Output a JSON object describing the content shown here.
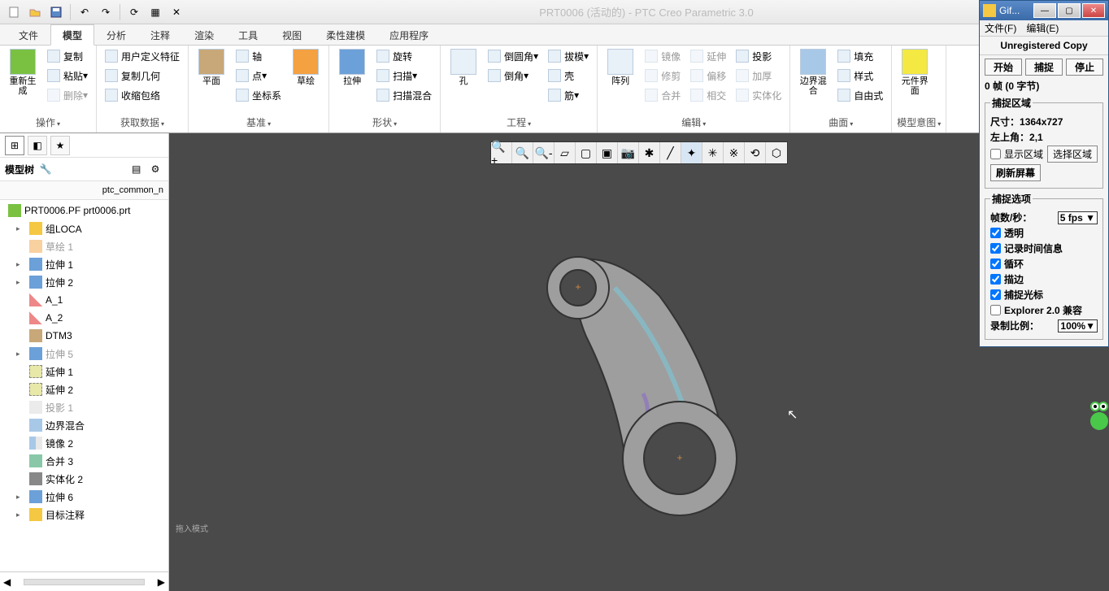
{
  "app_title": "PRT0006 (活动的) - PTC Creo Parametric 3.0",
  "tabs": [
    "文件",
    "模型",
    "分析",
    "注释",
    "渲染",
    "工具",
    "视图",
    "柔性建模",
    "应用程序"
  ],
  "active_tab": 1,
  "ribbon_groups": [
    {
      "label": "操作",
      "items": {
        "regen": "重新生成",
        "copy": "复制",
        "paste": "粘贴",
        "delete": "删除"
      }
    },
    {
      "label": "获取数据",
      "items": {
        "udf": "用户定义特征",
        "copygeom": "复制几何",
        "shrinkwrap": "收缩包络"
      }
    },
    {
      "label": "基准",
      "items": {
        "plane": "平面",
        "sketch": "草绘",
        "axis": "轴",
        "point": "点",
        "csys": "坐标系"
      }
    },
    {
      "label": "形状",
      "items": {
        "extrude": "拉伸",
        "revolve": "旋转",
        "sweep": "扫描",
        "sweepblend": "扫描混合"
      }
    },
    {
      "label": "工程",
      "items": {
        "hole": "孔",
        "round": "倒圆角",
        "chamfer": "倒角",
        "draft": "拔模",
        "shell": "壳",
        "rib": "筋"
      }
    },
    {
      "label": "编辑",
      "items": {
        "pattern": "阵列",
        "mirror": "镜像",
        "trim": "修剪",
        "merge": "合并",
        "extend": "延伸",
        "offset": "偏移",
        "intersect": "相交",
        "project": "投影",
        "thicken": "加厚",
        "solidify": "实体化"
      }
    },
    {
      "label": "曲面",
      "items": {
        "boundary": "边界混合",
        "fill": "填充",
        "style": "样式",
        "freeform": "自由式"
      }
    },
    {
      "label": "模型意图",
      "items": {
        "compinterface": "元件界面"
      }
    }
  ],
  "sidebar": {
    "title": "模型树",
    "search_path": "ptc_common_n",
    "filename": "PRT0006.PF prt0006.prt",
    "tree": [
      {
        "icon": "folder",
        "label": "组LOCA",
        "expand": true
      },
      {
        "icon": "sketch",
        "label": "草绘 1",
        "dim": true
      },
      {
        "icon": "extrude",
        "label": "拉伸 1",
        "expand": true
      },
      {
        "icon": "extrude",
        "label": "拉伸 2",
        "expand": true
      },
      {
        "icon": "axis",
        "label": "A_1"
      },
      {
        "icon": "axis",
        "label": "A_2"
      },
      {
        "icon": "datum",
        "label": "DTM3"
      },
      {
        "icon": "extrude",
        "label": "拉伸 5",
        "dim": true,
        "expand": true
      },
      {
        "icon": "extend",
        "label": "延伸 1"
      },
      {
        "icon": "extend",
        "label": "延伸 2"
      },
      {
        "icon": "project",
        "label": "投影 1",
        "dim": true
      },
      {
        "icon": "boundary",
        "label": "边界混合"
      },
      {
        "icon": "mirror",
        "label": "镜像 2"
      },
      {
        "icon": "merge",
        "label": "合并 3"
      },
      {
        "icon": "solidify",
        "label": "实体化 2"
      },
      {
        "icon": "extrude",
        "label": "拉伸 6",
        "expand": true
      },
      {
        "icon": "folder",
        "label": "目标注释",
        "expand": true
      }
    ]
  },
  "status_hint": "拖入模式",
  "gif": {
    "title": "Gif...",
    "menu": [
      "文件(F)",
      "编辑(E)"
    ],
    "banner": "Unregistered Copy",
    "buttons": {
      "start": "开始",
      "capture": "捕捉",
      "stop": "停止"
    },
    "frames_info": "0 帧 (0 字节)",
    "region": {
      "legend": "捕捉区域",
      "size_label": "尺寸：",
      "size_val": "1364x727",
      "corner_label": "左上角：",
      "corner_val": "2,1",
      "show_region": "显示区域",
      "select_region": "选择区域",
      "refresh": "刷新屏幕"
    },
    "options": {
      "legend": "捕捉选项",
      "fps_label": "帧数/秒：",
      "fps_val": "5 fps",
      "transparent": "透明",
      "timestamp": "记录时间信息",
      "loop": "循环",
      "outline": "描边",
      "cursor": "捕捉光标",
      "explorer": "Explorer 2.0 兼容",
      "scale_label": "录制比例：",
      "scale_val": "100%"
    }
  }
}
